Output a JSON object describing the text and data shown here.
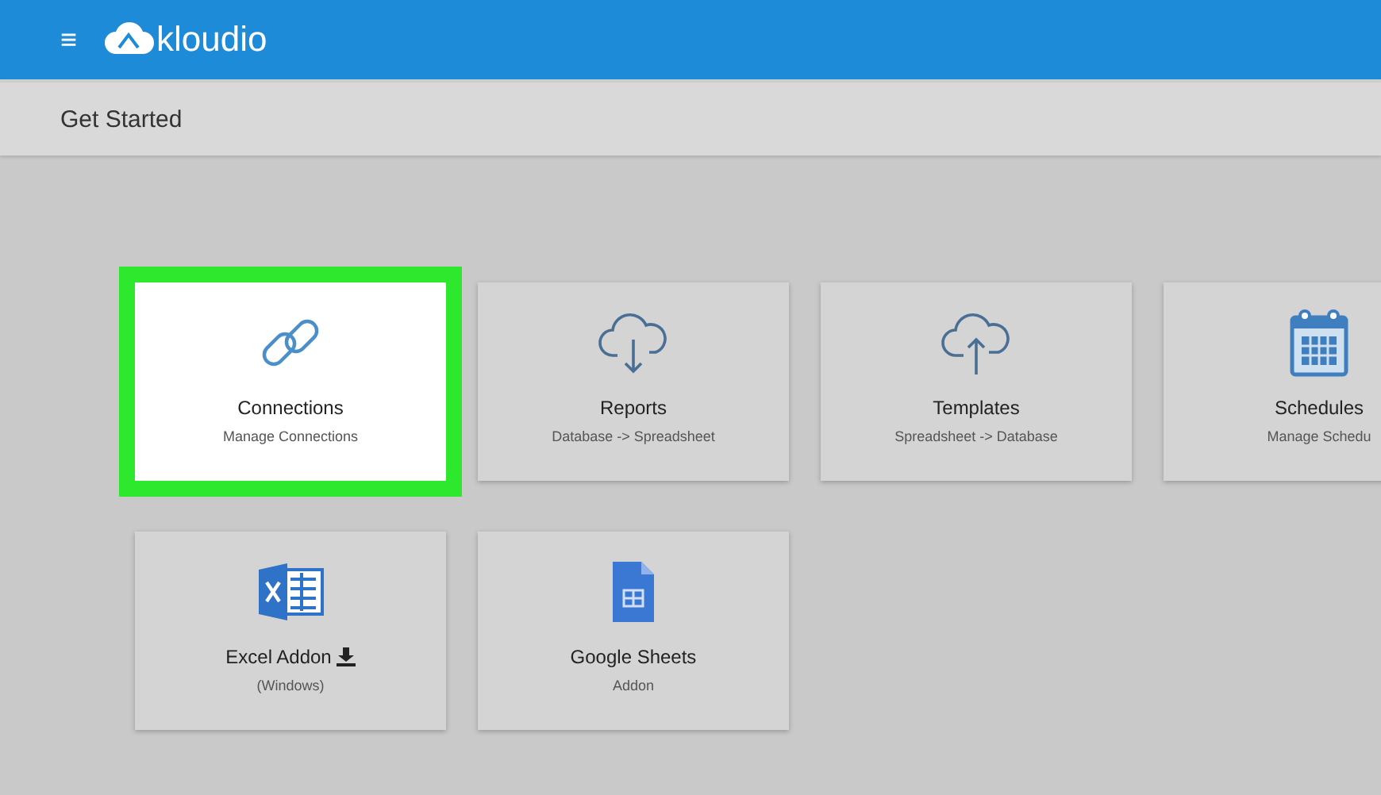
{
  "header": {
    "menu_icon": "≡",
    "logo": "kloudio"
  },
  "page_title": "Get Started",
  "cards": [
    {
      "kind": "link",
      "title": "Connections",
      "subtitle": "Manage Connections",
      "highlighted": true,
      "download": false
    },
    {
      "kind": "download",
      "title": "Reports",
      "subtitle": "Database -> Spreadsheet",
      "highlighted": false,
      "download": false
    },
    {
      "kind": "upload",
      "title": "Templates",
      "subtitle": "Spreadsheet -> Database",
      "highlighted": false,
      "download": false
    },
    {
      "kind": "calendar",
      "title": "Schedules",
      "subtitle": "Manage Schedu",
      "highlighted": false,
      "download": false
    },
    {
      "kind": "excel",
      "title": "Excel Addon",
      "subtitle": "(Windows)",
      "highlighted": false,
      "download": true
    },
    {
      "kind": "sheets",
      "title": "Google Sheets",
      "subtitle": "Addon",
      "highlighted": false,
      "download": false
    }
  ]
}
